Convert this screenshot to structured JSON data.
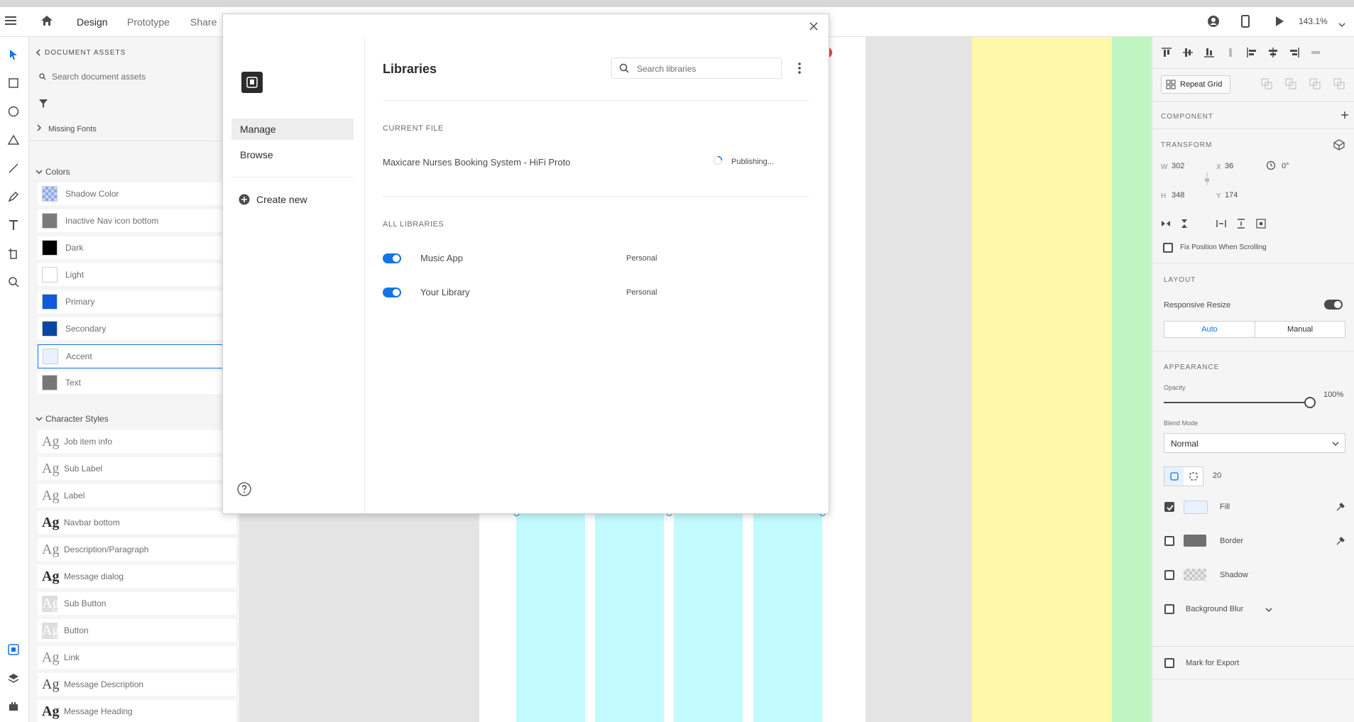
{
  "topbar": {
    "tabs": [
      "Design",
      "Prototype",
      "Share"
    ],
    "zoom": "143.1%"
  },
  "assets": {
    "title": "DOCUMENT ASSETS",
    "search_placeholder": "Search document assets",
    "missing_fonts": "Missing Fonts",
    "colors_label": "Colors",
    "colors": [
      {
        "name": "Shadow Color",
        "hex": "#9fb6e8"
      },
      {
        "name": "Inactive Nav icon bottom",
        "hex": "#7a7a7a"
      },
      {
        "name": "Dark",
        "hex": "#000000"
      },
      {
        "name": "Light",
        "hex": "#ffffff"
      },
      {
        "name": "Primary",
        "hex": "#1059d8"
      },
      {
        "name": "Secondary",
        "hex": "#0a47a0"
      },
      {
        "name": "Accent",
        "hex": "#e8f1ff"
      },
      {
        "name": "Text",
        "hex": "#777777"
      }
    ],
    "char_styles_label": "Character Styles",
    "char_styles": [
      {
        "glyph": "Ag",
        "name": "Job item info",
        "color": "#8a8a8a",
        "bold": false
      },
      {
        "glyph": "Ag",
        "name": "Sub Label",
        "color": "#8a8a8a",
        "bold": false
      },
      {
        "glyph": "Ag",
        "name": "Label",
        "color": "#8a8a8a",
        "bold": false
      },
      {
        "glyph": "Ag",
        "name": "Navbar bottom",
        "color": "#2c2c2c",
        "bold": true
      },
      {
        "glyph": "Ag",
        "name": "Description/Paragraph",
        "color": "#8a8a8a",
        "bold": false
      },
      {
        "glyph": "Ag",
        "name": "Message dialog",
        "color": "#2c2c2c",
        "bold": true
      },
      {
        "glyph": "Ag",
        "name": "Sub Button",
        "color": "#ffffff",
        "bold": false,
        "bg": "#dddddd"
      },
      {
        "glyph": "Ag",
        "name": "Button",
        "color": "#ffffff",
        "bold": false,
        "bg": "#dddddd"
      },
      {
        "glyph": "Ag",
        "name": "Link",
        "color": "#8a8a8a",
        "bold": false
      },
      {
        "glyph": "Ag",
        "name": "Message Description",
        "color": "#4b4b4b",
        "bold": false
      },
      {
        "glyph": "Ag",
        "name": "Message Heading",
        "color": "#2c2c2c",
        "bold": true
      }
    ]
  },
  "libraries": {
    "title": "Libraries",
    "search_placeholder": "Search libraries",
    "nav": [
      "Manage",
      "Browse"
    ],
    "create_new": "Create new",
    "current_file_label": "CURRENT FILE",
    "current_file_name": "Maxicare Nurses Booking System - HiFi Proto",
    "current_file_status": "Publishing...",
    "all_libraries_label": "ALL LIBRARIES",
    "items": [
      {
        "name": "Music App",
        "owner": "Personal",
        "enabled": true
      },
      {
        "name": "Your Library",
        "owner": "Personal",
        "enabled": true
      }
    ]
  },
  "props": {
    "repeat_grid": "Repeat Grid",
    "component_label": "COMPONENT",
    "transform_label": "TRANSFORM",
    "w_label": "W",
    "w": "302",
    "x_label": "X",
    "x": "36",
    "rotation": "0°",
    "h_label": "H",
    "h": "348",
    "y_label": "Y",
    "y": "174",
    "fix_position": "Fix Position When Scrolling",
    "layout_label": "LAYOUT",
    "responsive_resize": "Responsive Resize",
    "auto": "Auto",
    "manual": "Manual",
    "appearance_label": "APPEARANCE",
    "opacity_label": "Opacity",
    "opacity": "100%",
    "opacity_value": 1.0,
    "blend_label": "Blend Mode",
    "blend_value": "Normal",
    "radius": "20",
    "fill_label": "Fill",
    "fill_checked": true,
    "fill_color": "#e8f1ff",
    "border_label": "Border",
    "border_color": "#707070",
    "shadow_label": "Shadow",
    "bg_blur_label": "Background Blur",
    "export_label": "Mark for Export"
  }
}
